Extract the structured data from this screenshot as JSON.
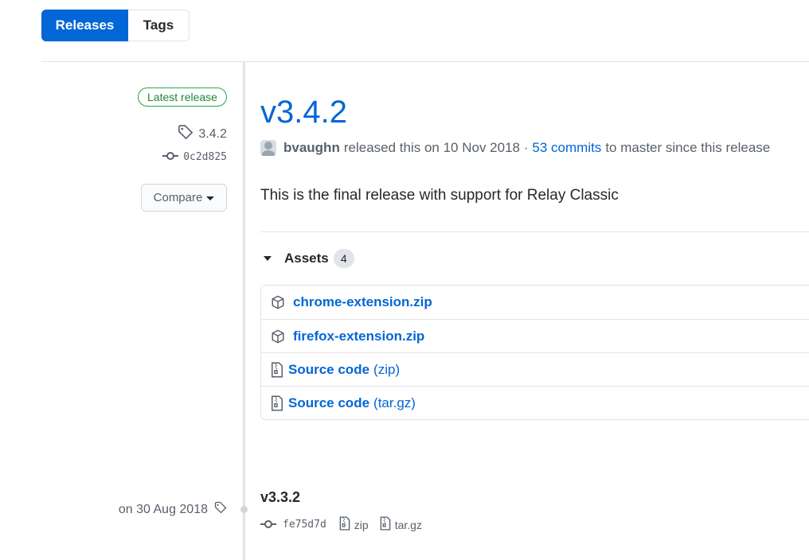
{
  "tabs": {
    "releases": "Releases",
    "tags": "Tags"
  },
  "latest": {
    "badge": "Latest release",
    "tag": "3.4.2",
    "commit": "0c2d825",
    "compare": "Compare",
    "title": "v3.4.2",
    "author": "bvaughn",
    "released_text": "released this on 10 Nov 2018 ·",
    "commits_link": "53 commits",
    "commits_suffix": "to master since this release",
    "body": "This is the final release with support for Relay Classic",
    "assets_label": "Assets",
    "assets_count": "4",
    "assets": [
      {
        "name": "chrome-extension.zip",
        "icon": "package-icon"
      },
      {
        "name": "firefox-extension.zip",
        "icon": "package-icon"
      },
      {
        "name": "Source code",
        "ext": "(zip)",
        "icon": "file-zip-icon"
      },
      {
        "name": "Source code",
        "ext": "(tar.gz)",
        "icon": "file-zip-icon"
      }
    ]
  },
  "older": {
    "date": "on 30 Aug 2018",
    "title": "v3.3.2",
    "commit": "fe75d7d",
    "zip": "zip",
    "targz": "tar.gz"
  },
  "colors": {
    "accent": "#0366d6",
    "success": "#28a745",
    "muted": "#586069",
    "border": "#e1e4e8"
  }
}
